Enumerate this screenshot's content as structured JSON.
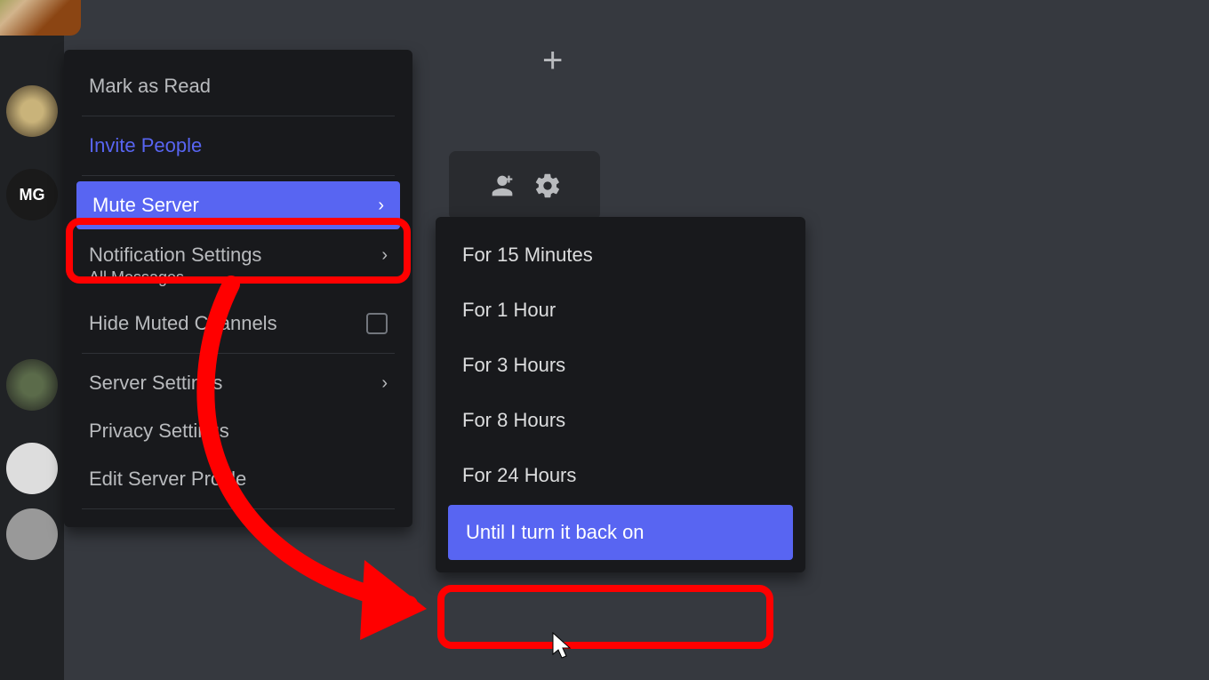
{
  "servers": {
    "s2_label": "MG"
  },
  "menu": {
    "mark_read": "Mark as Read",
    "invite": "Invite People",
    "mute": "Mute Server",
    "notif": "Notification Settings",
    "notif_sub": "All Messages",
    "hide_muted": "Hide Muted Channels",
    "server_settings": "Server Settings",
    "privacy": "Privacy Settings",
    "edit_profile": "Edit Server Profile"
  },
  "submenu": {
    "min15": "For 15 Minutes",
    "hr1": "For 1 Hour",
    "hr3": "For 3 Hours",
    "hr8": "For 8 Hours",
    "hr24": "For 24 Hours",
    "until": "Until I turn it back on"
  }
}
